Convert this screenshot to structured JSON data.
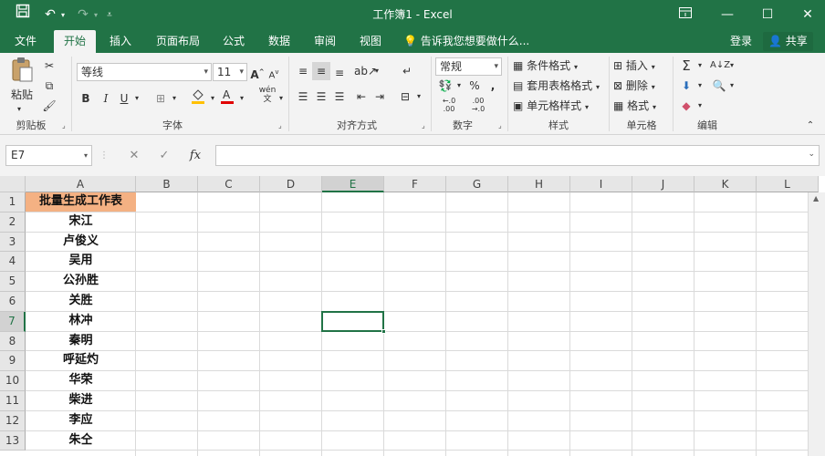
{
  "app": {
    "title": "工作簿1 - Excel"
  },
  "titlebar": {
    "save_icon": "save-icon",
    "undo_icon": "undo-icon",
    "redo_icon": "redo-icon",
    "customize_icon": "customize-qat-icon"
  },
  "tabs": [
    {
      "label": "文件"
    },
    {
      "label": "开始"
    },
    {
      "label": "插入"
    },
    {
      "label": "页面布局"
    },
    {
      "label": "公式"
    },
    {
      "label": "数据"
    },
    {
      "label": "审阅"
    },
    {
      "label": "视图"
    }
  ],
  "tellme": "告诉我您想要做什么...",
  "signin": "登录",
  "share": "共享",
  "ribbon": {
    "clipboard": {
      "paste": "粘贴",
      "label": "剪贴板"
    },
    "font": {
      "name": "等线",
      "size": "11",
      "bold": "B",
      "italic": "I",
      "underline": "U",
      "label": "字体",
      "wen": "wén",
      "grow": "A",
      "shrink": "A"
    },
    "alignment": {
      "label": "对齐方式"
    },
    "number": {
      "format": "常规",
      "percent": "%",
      "comma": ",",
      "inc": "←.0 .00",
      "dec": ".00 →.0",
      "label": "数字"
    },
    "styles": {
      "conditional": "条件格式",
      "table": "套用表格格式",
      "cell": "单元格样式",
      "label": "样式"
    },
    "cells": {
      "insert": "插入",
      "delete": "删除",
      "format": "格式",
      "label": "单元格"
    },
    "editing": {
      "label": "编辑",
      "sum": "Σ"
    }
  },
  "formula_bar": {
    "name_box": "E7",
    "cancel": "✕",
    "confirm": "✓",
    "fx": "fx",
    "content": ""
  },
  "columns": [
    "A",
    "B",
    "C",
    "D",
    "E",
    "F",
    "G",
    "H",
    "I",
    "J",
    "K",
    "L"
  ],
  "selected_column": "E",
  "rows": [
    "1",
    "2",
    "3",
    "4",
    "5",
    "6",
    "7",
    "8",
    "9",
    "10",
    "11",
    "12",
    "13"
  ],
  "selected_row": "7",
  "column_a": [
    "批量生成工作表",
    "宋江",
    "卢俊义",
    "吴用",
    "公孙胜",
    "关胜",
    "林冲",
    "秦明",
    "呼延灼",
    "华荣",
    "柴进",
    "李应",
    "朱仝"
  ],
  "colors": {
    "brand": "#217346",
    "header_fill": "#f4b183"
  }
}
